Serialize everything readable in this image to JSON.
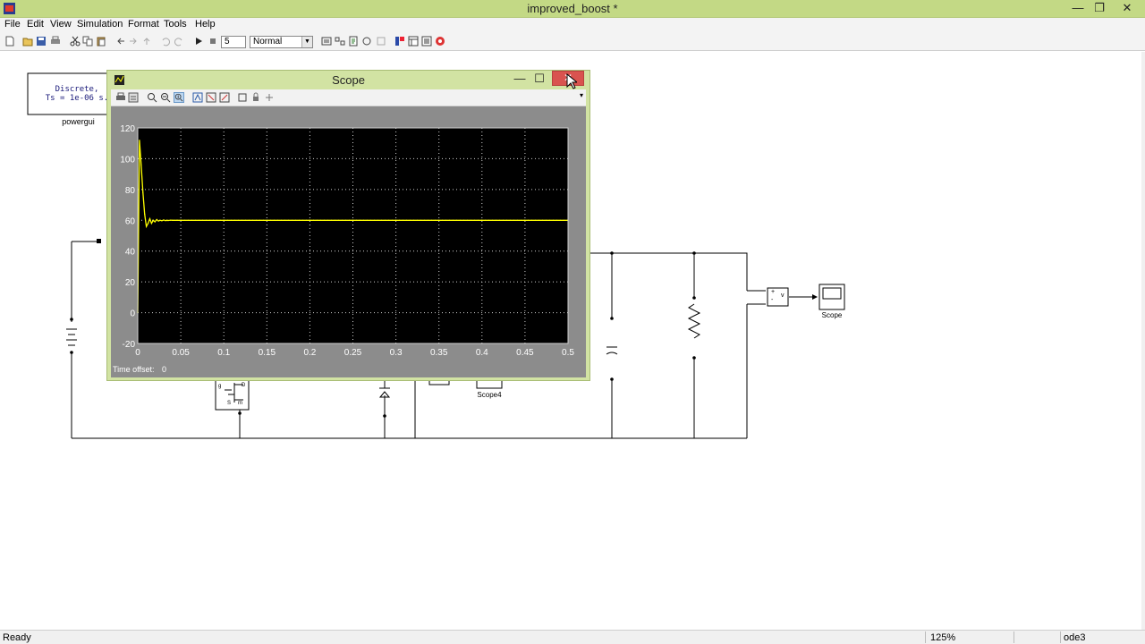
{
  "window": {
    "title": "improved_boost *",
    "controls": {
      "minimize": "—",
      "restore": "❐",
      "close": "✕"
    }
  },
  "menu": [
    "File",
    "Edit",
    "View",
    "Simulation",
    "Format",
    "Tools",
    "Help"
  ],
  "toolbar": {
    "stop_time": "5",
    "sim_mode": "Normal"
  },
  "model": {
    "powergui": {
      "line1": "Discrete,",
      "line2": "Ts = 1e-06 s.",
      "label": "powergui"
    },
    "scope_block_label": "Scope",
    "scope4_label": "Scope4",
    "voltmeter_plus": "+",
    "voltmeter_minus": "-",
    "voltmeter_v": "v",
    "mosfet_g": "g",
    "mosfet_d": "D",
    "mosfet_s": "S",
    "mosfet_m": "m"
  },
  "scope": {
    "title": "Scope",
    "controls": {
      "minimize": "—",
      "maximize": "☐",
      "close": "✕"
    },
    "time_offset_label": "Time offset:",
    "time_offset_value": "0"
  },
  "chart_data": {
    "type": "line",
    "title": "",
    "xlabel": "",
    "ylabel": "",
    "xlim": [
      0,
      0.5
    ],
    "ylim": [
      -20,
      120
    ],
    "xticks": [
      "0",
      "0.05",
      "0.1",
      "0.15",
      "0.2",
      "0.25",
      "0.3",
      "0.35",
      "0.4",
      "0.45",
      "0.5"
    ],
    "yticks": [
      "-20",
      "0",
      "20",
      "40",
      "60",
      "80",
      "100",
      "120"
    ],
    "grid": true,
    "background": "#000000",
    "series": [
      {
        "color": "#ffff00",
        "x": [
          0,
          0.002,
          0.004,
          0.006,
          0.008,
          0.01,
          0.012,
          0.014,
          0.016,
          0.018,
          0.02,
          0.022,
          0.024,
          0.026,
          0.028,
          0.03,
          0.032,
          0.034,
          0.036,
          0.038,
          0.04,
          0.045,
          0.05,
          0.1,
          0.2,
          0.3,
          0.4,
          0.5
        ],
        "values": [
          0,
          112,
          96,
          78,
          64,
          56,
          58,
          61,
          58,
          60,
          59,
          60.5,
          59.5,
          60,
          59.7,
          60.2,
          59.8,
          60,
          59.9,
          60.1,
          60,
          60,
          60,
          60,
          60,
          60,
          60,
          60
        ]
      }
    ]
  },
  "status": {
    "left": "Ready",
    "zoom": "125%",
    "solver": "ode3"
  }
}
